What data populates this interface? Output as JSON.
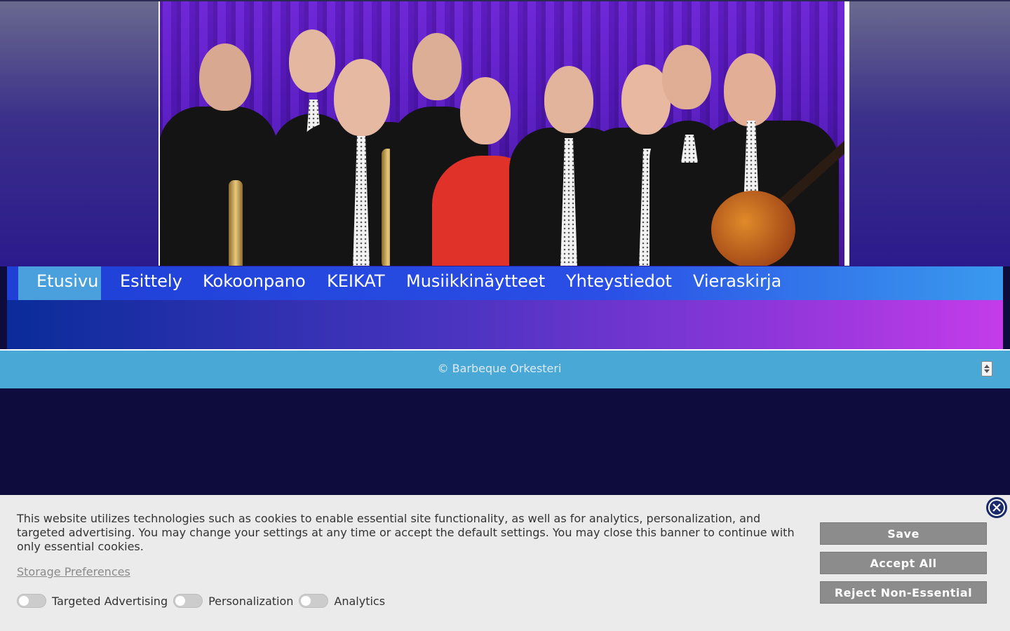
{
  "nav": {
    "items": [
      {
        "label": "Etusivu",
        "active": true
      },
      {
        "label": "Esittely"
      },
      {
        "label": "Kokoonpano"
      },
      {
        "label": "KEIKAT"
      },
      {
        "label": "Musiikkinäytteet"
      },
      {
        "label": "Yhteystiedot"
      },
      {
        "label": "Vieraskirja"
      }
    ]
  },
  "footer": {
    "copyright": "© Barbeque Orkesteri"
  },
  "cookie_banner": {
    "text": "This website utilizes technologies such as cookies to enable essential site functionality, as well as for analytics, personalization, and targeted advertising. You may change your settings at any time or accept the default settings. You may close this banner to continue with only essential cookies.",
    "preferences_link": "Storage Preferences",
    "toggles": [
      {
        "label": "Targeted Advertising",
        "on": false
      },
      {
        "label": "Personalization",
        "on": false
      },
      {
        "label": "Analytics",
        "on": false
      }
    ],
    "buttons": {
      "save": "Save",
      "accept_all": "Accept All",
      "reject": "Reject Non-Essential"
    }
  },
  "colors": {
    "page_bg": "#0e0b3d",
    "nav_active": "#4aa0dc",
    "footer_bg": "#4aa8d6",
    "button_bg": "#8c8c8c"
  },
  "icons": {
    "close": "close-icon",
    "scroll_top": "scroll-top-icon"
  }
}
